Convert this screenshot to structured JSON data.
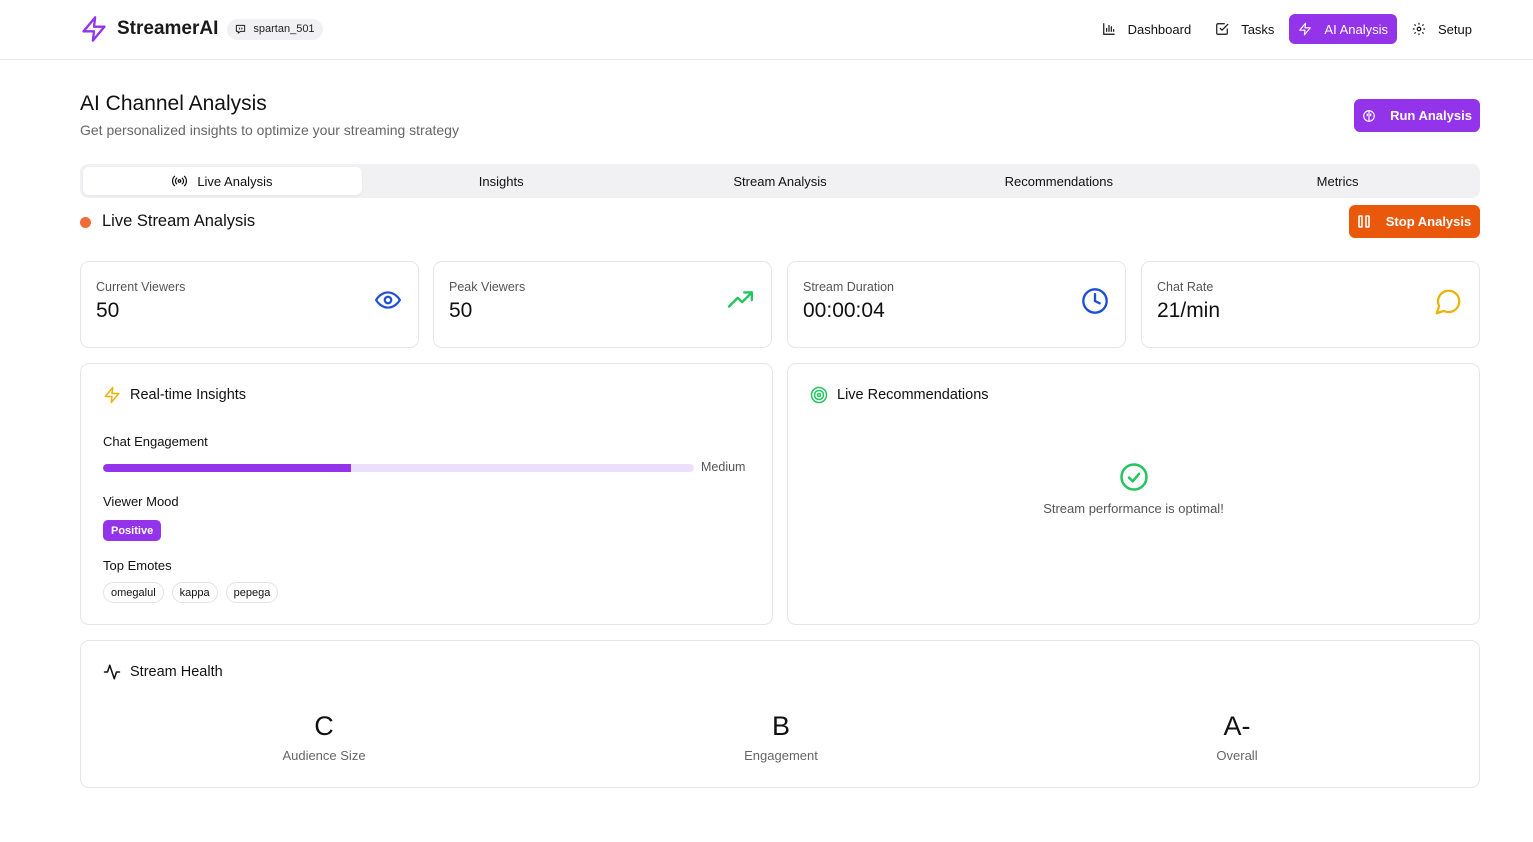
{
  "brand": {
    "name": "StreamerAI",
    "username": "spartan_501"
  },
  "nav": [
    {
      "label": "Dashboard",
      "icon": "bar-chart-icon",
      "active": false
    },
    {
      "label": "Tasks",
      "icon": "check-square-icon",
      "active": false
    },
    {
      "label": "AI Analysis",
      "icon": "zap-icon",
      "active": true
    },
    {
      "label": "Setup",
      "icon": "gear-icon",
      "active": false
    }
  ],
  "header": {
    "title": "AI Channel Analysis",
    "subtitle": "Get personalized insights to optimize your streaming strategy",
    "run_button": "Run Analysis"
  },
  "tabs": [
    {
      "label": "Live Analysis",
      "active": true
    },
    {
      "label": "Insights",
      "active": false
    },
    {
      "label": "Stream Analysis",
      "active": false
    },
    {
      "label": "Recommendations",
      "active": false
    },
    {
      "label": "Metrics",
      "active": false
    }
  ],
  "live": {
    "title": "Live Stream Analysis",
    "stop_button": "Stop Analysis",
    "status_color": "#f26b3a"
  },
  "stats": [
    {
      "label": "Current Viewers",
      "value": "50",
      "icon": "eye-icon",
      "color": "#1d4ed8"
    },
    {
      "label": "Peak Viewers",
      "value": "50",
      "icon": "trending-up-icon",
      "color": "#22c55e"
    },
    {
      "label": "Stream Duration",
      "value": "00:00:04",
      "icon": "clock-icon",
      "color": "#1d4ed8"
    },
    {
      "label": "Chat Rate",
      "value": "21/min",
      "icon": "chat-bubble-icon",
      "color": "#eab308"
    }
  ],
  "insights": {
    "title": "Real-time Insights",
    "chat_engagement_label": "Chat Engagement",
    "chat_engagement_level": "Medium",
    "chat_engagement_fraction": 0.42,
    "viewer_mood_label": "Viewer Mood",
    "viewer_mood": "Positive",
    "top_emotes_label": "Top Emotes",
    "emotes": [
      "omegalul",
      "kappa",
      "pepega"
    ]
  },
  "recommendations": {
    "title": "Live Recommendations",
    "message": "Stream performance is optimal!"
  },
  "health": {
    "title": "Stream Health",
    "grades": [
      {
        "grade": "C",
        "label": "Audience Size"
      },
      {
        "grade": "B",
        "label": "Engagement"
      },
      {
        "grade": "A-",
        "label": "Overall"
      }
    ]
  },
  "colors": {
    "accent": "#9333ea",
    "stop": "#ea580c",
    "success": "#22c55e"
  }
}
